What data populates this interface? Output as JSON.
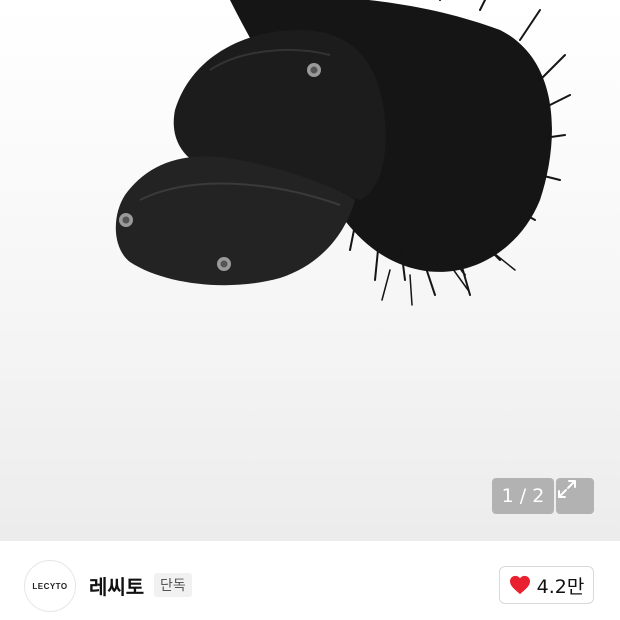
{
  "image": {
    "counter_current": "1",
    "counter_separator": " / ",
    "counter_total": "2",
    "expand_icon": "expand-arrows-icon"
  },
  "brand": {
    "logo_text": "LECYTO",
    "name": "레씨토",
    "badge": "단독"
  },
  "like": {
    "icon": "heart-icon",
    "count": "4.2만",
    "color": "#e8202f"
  }
}
